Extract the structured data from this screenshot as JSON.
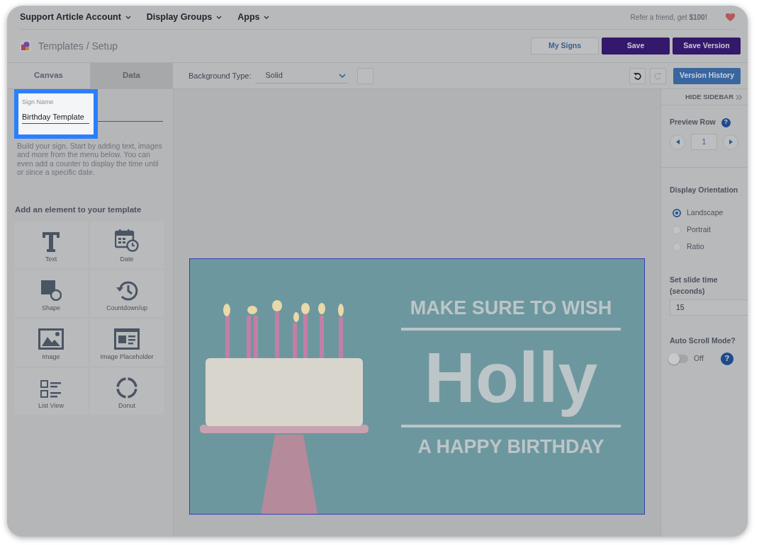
{
  "nav": {
    "menus": [
      {
        "label": "Support Article Account"
      },
      {
        "label": "Display Groups"
      },
      {
        "label": "Apps"
      }
    ],
    "referral": "Refer a friend, get **$100!**"
  },
  "breadcrumb": "Templates / Setup",
  "header_buttons": [
    {
      "label": "My Signs",
      "kind": "outline"
    },
    {
      "label": "Save",
      "kind": "primary"
    },
    {
      "label": "Save Version",
      "kind": "primary"
    }
  ],
  "tabs": [
    {
      "label": "Canvas",
      "selected": true
    },
    {
      "label": "Data",
      "selected": false
    }
  ],
  "toolbar": {
    "background_label": "Background Type:",
    "background_type": "Solid",
    "redo_disabled": true,
    "version_history": "Version History"
  },
  "sign_name": {
    "label": "Sign Name",
    "value": "Birthday Template",
    "highlighted": true
  },
  "intro": "Build your sign. Start by adding text, images and more from the menu below. You can even add a counter to display the time until or since a specific date.",
  "elements_heading": "Add an element to your template",
  "elements": [
    {
      "label": "Text",
      "kind": "text"
    },
    {
      "label": "Date",
      "kind": "date"
    },
    {
      "label": "Shape",
      "kind": "shape"
    },
    {
      "label": "Countdown/up",
      "kind": "countdown"
    },
    {
      "label": "Image",
      "kind": "image"
    },
    {
      "label": "Image Placeholder",
      "kind": "placeholder"
    },
    {
      "label": "List View",
      "kind": "list"
    },
    {
      "label": "Donut",
      "kind": "donut"
    }
  ],
  "sign": {
    "top_line": "MAKE SURE TO WISH",
    "name": "Holly",
    "bottom_line": "A HAPPY BIRTHDAY"
  },
  "sidebar": {
    "hide": "HIDE SIDEBAR",
    "preview_label": "Preview Row",
    "preview_help": "?",
    "preview_row": "1",
    "orientation_label": "Display Orientation",
    "orientations": [
      {
        "label": "Landscape",
        "selected": true
      },
      {
        "label": "Portrait",
        "selected": false
      },
      {
        "label": "Ratio",
        "selected": false
      }
    ],
    "slide_time_label": "Set slide time (seconds)",
    "slide_time": "15",
    "auto_scroll_label": "Auto Scroll Mode?",
    "auto_scroll": {
      "on": false,
      "label": "Off"
    },
    "auto_scroll_help": "?"
  }
}
